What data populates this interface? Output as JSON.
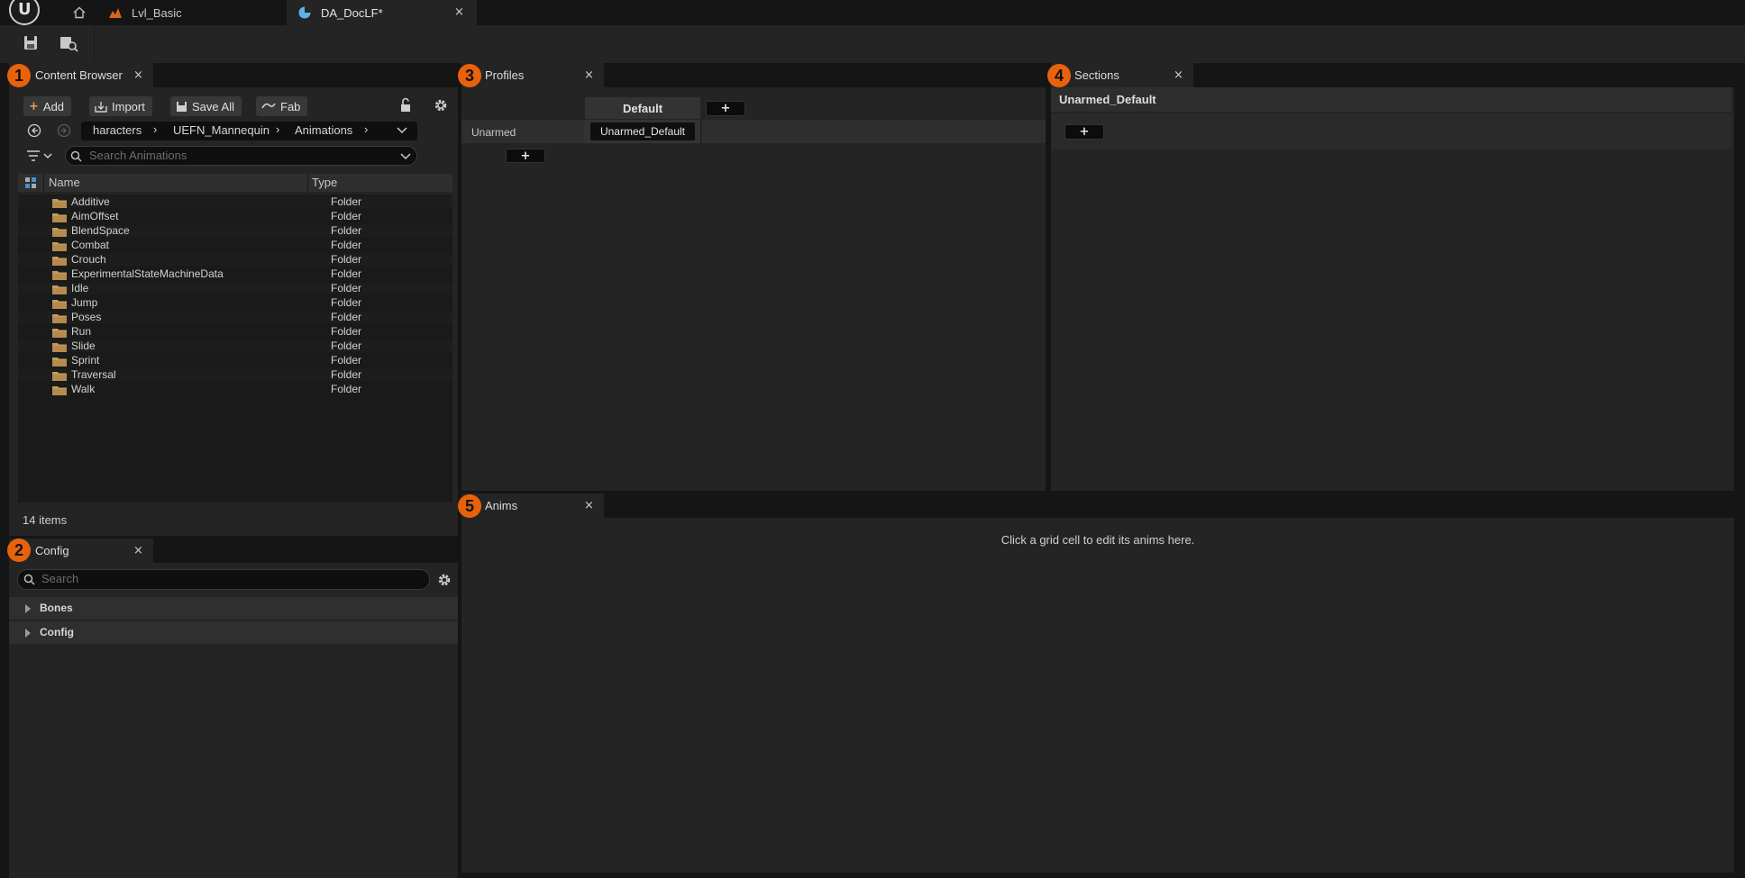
{
  "title_bar": {
    "logo_letter": "U",
    "tabs": [
      {
        "label": "Lvl_Basic"
      },
      {
        "label": "DA_DocLF*"
      }
    ],
    "close_glyph": "×"
  },
  "toolbar": {
    "buttons": [
      "save-icon",
      "browse-asset-icon"
    ]
  },
  "panels": {
    "content_browser": {
      "badge": "1",
      "title": "Content Browser",
      "buttons": {
        "add": "Add",
        "import": "Import",
        "save_all": "Save All",
        "fab": "Fab"
      },
      "path": [
        "haracters",
        "UEFN_Mannequin",
        "Animations"
      ],
      "search_placeholder": "Search Animations",
      "columns": {
        "name": "Name",
        "type": "Type"
      },
      "items": [
        {
          "name": "Additive",
          "type": "Folder"
        },
        {
          "name": "AimOffset",
          "type": "Folder"
        },
        {
          "name": "BlendSpace",
          "type": "Folder"
        },
        {
          "name": "Combat",
          "type": "Folder"
        },
        {
          "name": "Crouch",
          "type": "Folder"
        },
        {
          "name": "ExperimentalStateMachineData",
          "type": "Folder"
        },
        {
          "name": "Idle",
          "type": "Folder"
        },
        {
          "name": "Jump",
          "type": "Folder"
        },
        {
          "name": "Poses",
          "type": "Folder"
        },
        {
          "name": "Run",
          "type": "Folder"
        },
        {
          "name": "Slide",
          "type": "Folder"
        },
        {
          "name": "Sprint",
          "type": "Folder"
        },
        {
          "name": "Traversal",
          "type": "Folder"
        },
        {
          "name": "Walk",
          "type": "Folder"
        }
      ],
      "item_count": "14 items"
    },
    "config": {
      "badge": "2",
      "title": "Config",
      "search_placeholder": "Search",
      "categories": [
        "Bones",
        "Config"
      ]
    },
    "profiles": {
      "badge": "3",
      "title": "Profiles",
      "column_header": "Default",
      "row_label": "Unarmed",
      "cell_value": "Unarmed_Default",
      "add_glyph": "+"
    },
    "sections": {
      "badge": "4",
      "title": "Sections",
      "header": "Unarmed_Default",
      "add_glyph": "+"
    },
    "anims": {
      "badge": "5",
      "title": "Anims",
      "hint": "Click a grid cell to edit its anims here."
    }
  },
  "colors": {
    "background": "#151515",
    "panel": "#242424",
    "badge": "#e8620c",
    "folder": "#c49a5c"
  }
}
